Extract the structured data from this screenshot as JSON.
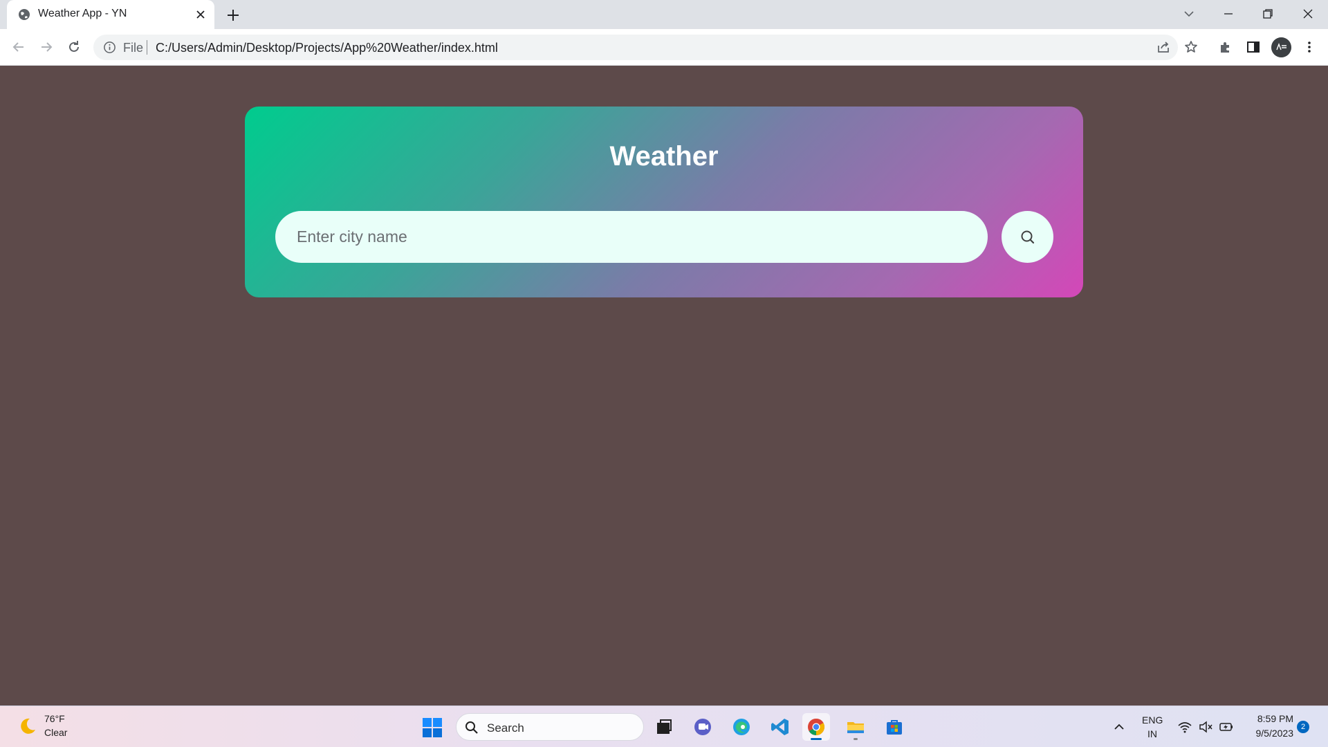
{
  "browser": {
    "tab_title": "Weather App - YN",
    "url_scheme_label": "File",
    "url": "C:/Users/Admin/Desktop/Projects/App%20Weather/index.html"
  },
  "app": {
    "title": "Weather",
    "search_placeholder": "Enter city name",
    "search_value": "",
    "colors": {
      "page_background": "#5d4a4a",
      "gradient_start": "#00cc8e",
      "gradient_end": "#d447b8",
      "input_background": "#e9fff9"
    }
  },
  "taskbar": {
    "weather_temp": "76°F",
    "weather_condition": "Clear",
    "search_label": "Search",
    "apps": [
      "task-view",
      "teams-chat",
      "edge",
      "vscode",
      "chrome",
      "file-explorer",
      "microsoft-store"
    ],
    "language_line1": "ENG",
    "language_line2": "IN",
    "time": "8:59 PM",
    "date": "9/5/2023",
    "notification_count": "2"
  }
}
